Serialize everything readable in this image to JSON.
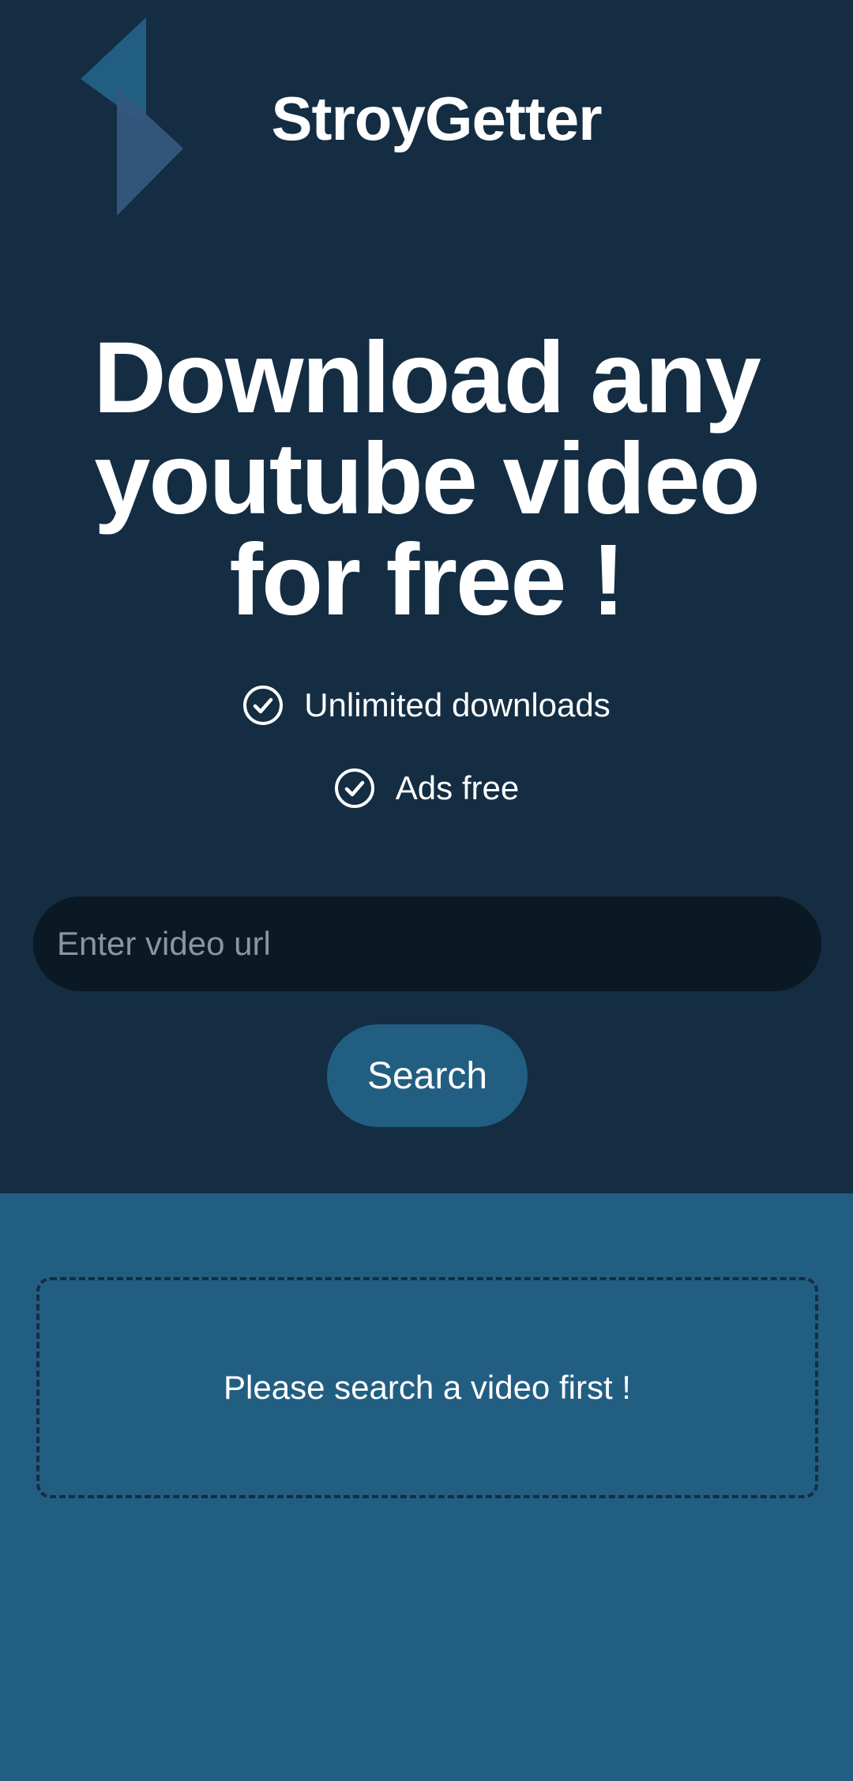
{
  "app": {
    "brand": "StroyGetter",
    "logo_icon": "bolt-logo-icon"
  },
  "hero": {
    "headline": "Download any youtube video for free !",
    "features": [
      {
        "icon": "check-circle-icon",
        "label": "Unlimited downloads"
      },
      {
        "icon": "check-circle-icon",
        "label": "Ads free"
      }
    ]
  },
  "search": {
    "placeholder": "Enter video url",
    "value": "",
    "button_label": "Search"
  },
  "results": {
    "empty_message": "Please search a video first !"
  },
  "colors": {
    "hero_background": "#142d43",
    "page_background": "#225e82",
    "input_background": "#0b1924",
    "accent": "#225e82"
  }
}
